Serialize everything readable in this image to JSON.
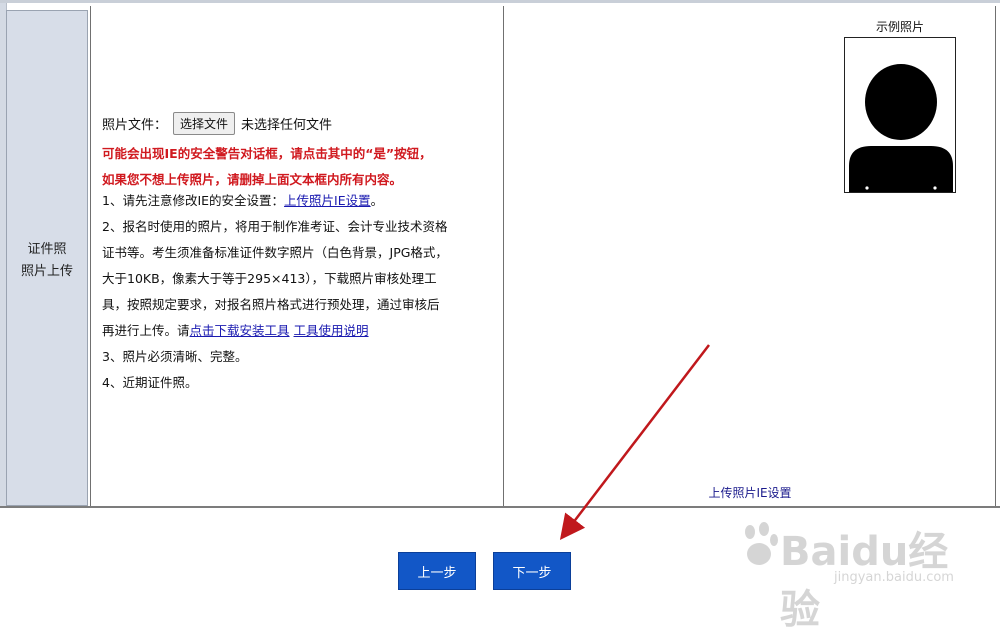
{
  "row_label": [
    "证件照",
    "照片上传"
  ],
  "upload": {
    "label": "照片文件：",
    "button": "选择文件",
    "status": "未选择任何文件"
  },
  "warnings": [
    "可能会出现IE的安全警告对话框，请点击其中的“是”按钮，",
    "如果您不想上传照片，请删掉上面文本框内所有内容。"
  ],
  "instructions": {
    "item1_prefix": "1、请先注意修改IE的安全设置：",
    "item1_link": "上传照片IE设置",
    "item1_suffix": "。",
    "item2_lines": [
      "2、报名时使用的照片，将用于制作准考证、会计专业技术资格",
      "证书等。考生须准备标准证件数字照片（白色背景，JPG格式，",
      "大于10KB，像素大于等于295×413），下载照片审核处理工",
      "具，按照规定要求，对报名照片格式进行预处理，通过审核后"
    ],
    "item2_last_prefix": "再进行上传。请",
    "item2_link1": "点击下载安装工具",
    "item2_link2": "工具使用说明",
    "item3": "3、照片必须清晰、完整。",
    "item4": "4、近期证件照。"
  },
  "sample": {
    "title": "示例照片",
    "bottom_link": "上传照片IE设置"
  },
  "nav": {
    "prev": "上一步",
    "next": "下一步"
  },
  "watermark": {
    "brand": "Baidu经验",
    "url": "jingyan.baidu.com"
  },
  "colors": {
    "button_blue": "#1257c7",
    "warning_red": "#d0191f",
    "link_blue": "#1a1ab0",
    "arrow_red": "#c0181c"
  }
}
